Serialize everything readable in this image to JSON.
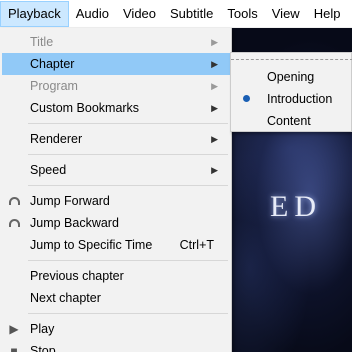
{
  "menubar": {
    "items": [
      {
        "label": "Playback",
        "active": true
      },
      {
        "label": "Audio"
      },
      {
        "label": "Video"
      },
      {
        "label": "Subtitle"
      },
      {
        "label": "Tools"
      },
      {
        "label": "View"
      },
      {
        "label": "Help"
      }
    ]
  },
  "playback_menu": {
    "title": "Title",
    "chapter": "Chapter",
    "program": "Program",
    "custom_bookmarks": "Custom Bookmarks",
    "renderer": "Renderer",
    "speed": "Speed",
    "jump_forward": "Jump Forward",
    "jump_backward": "Jump Backward",
    "jump_specific": "Jump to Specific Time",
    "jump_specific_shortcut": "Ctrl+T",
    "previous_chapter": "Previous chapter",
    "next_chapter": "Next chapter",
    "play": "Play",
    "stop": "Stop"
  },
  "chapter_submenu": {
    "items": [
      {
        "label": "Opening",
        "selected": false
      },
      {
        "label": "Introduction",
        "selected": true
      },
      {
        "label": "Content",
        "selected": false
      }
    ]
  },
  "video": {
    "overlay_text": "ED"
  },
  "icons": {
    "submenu_arrow": "▶",
    "play": "▶",
    "stop": "■"
  }
}
